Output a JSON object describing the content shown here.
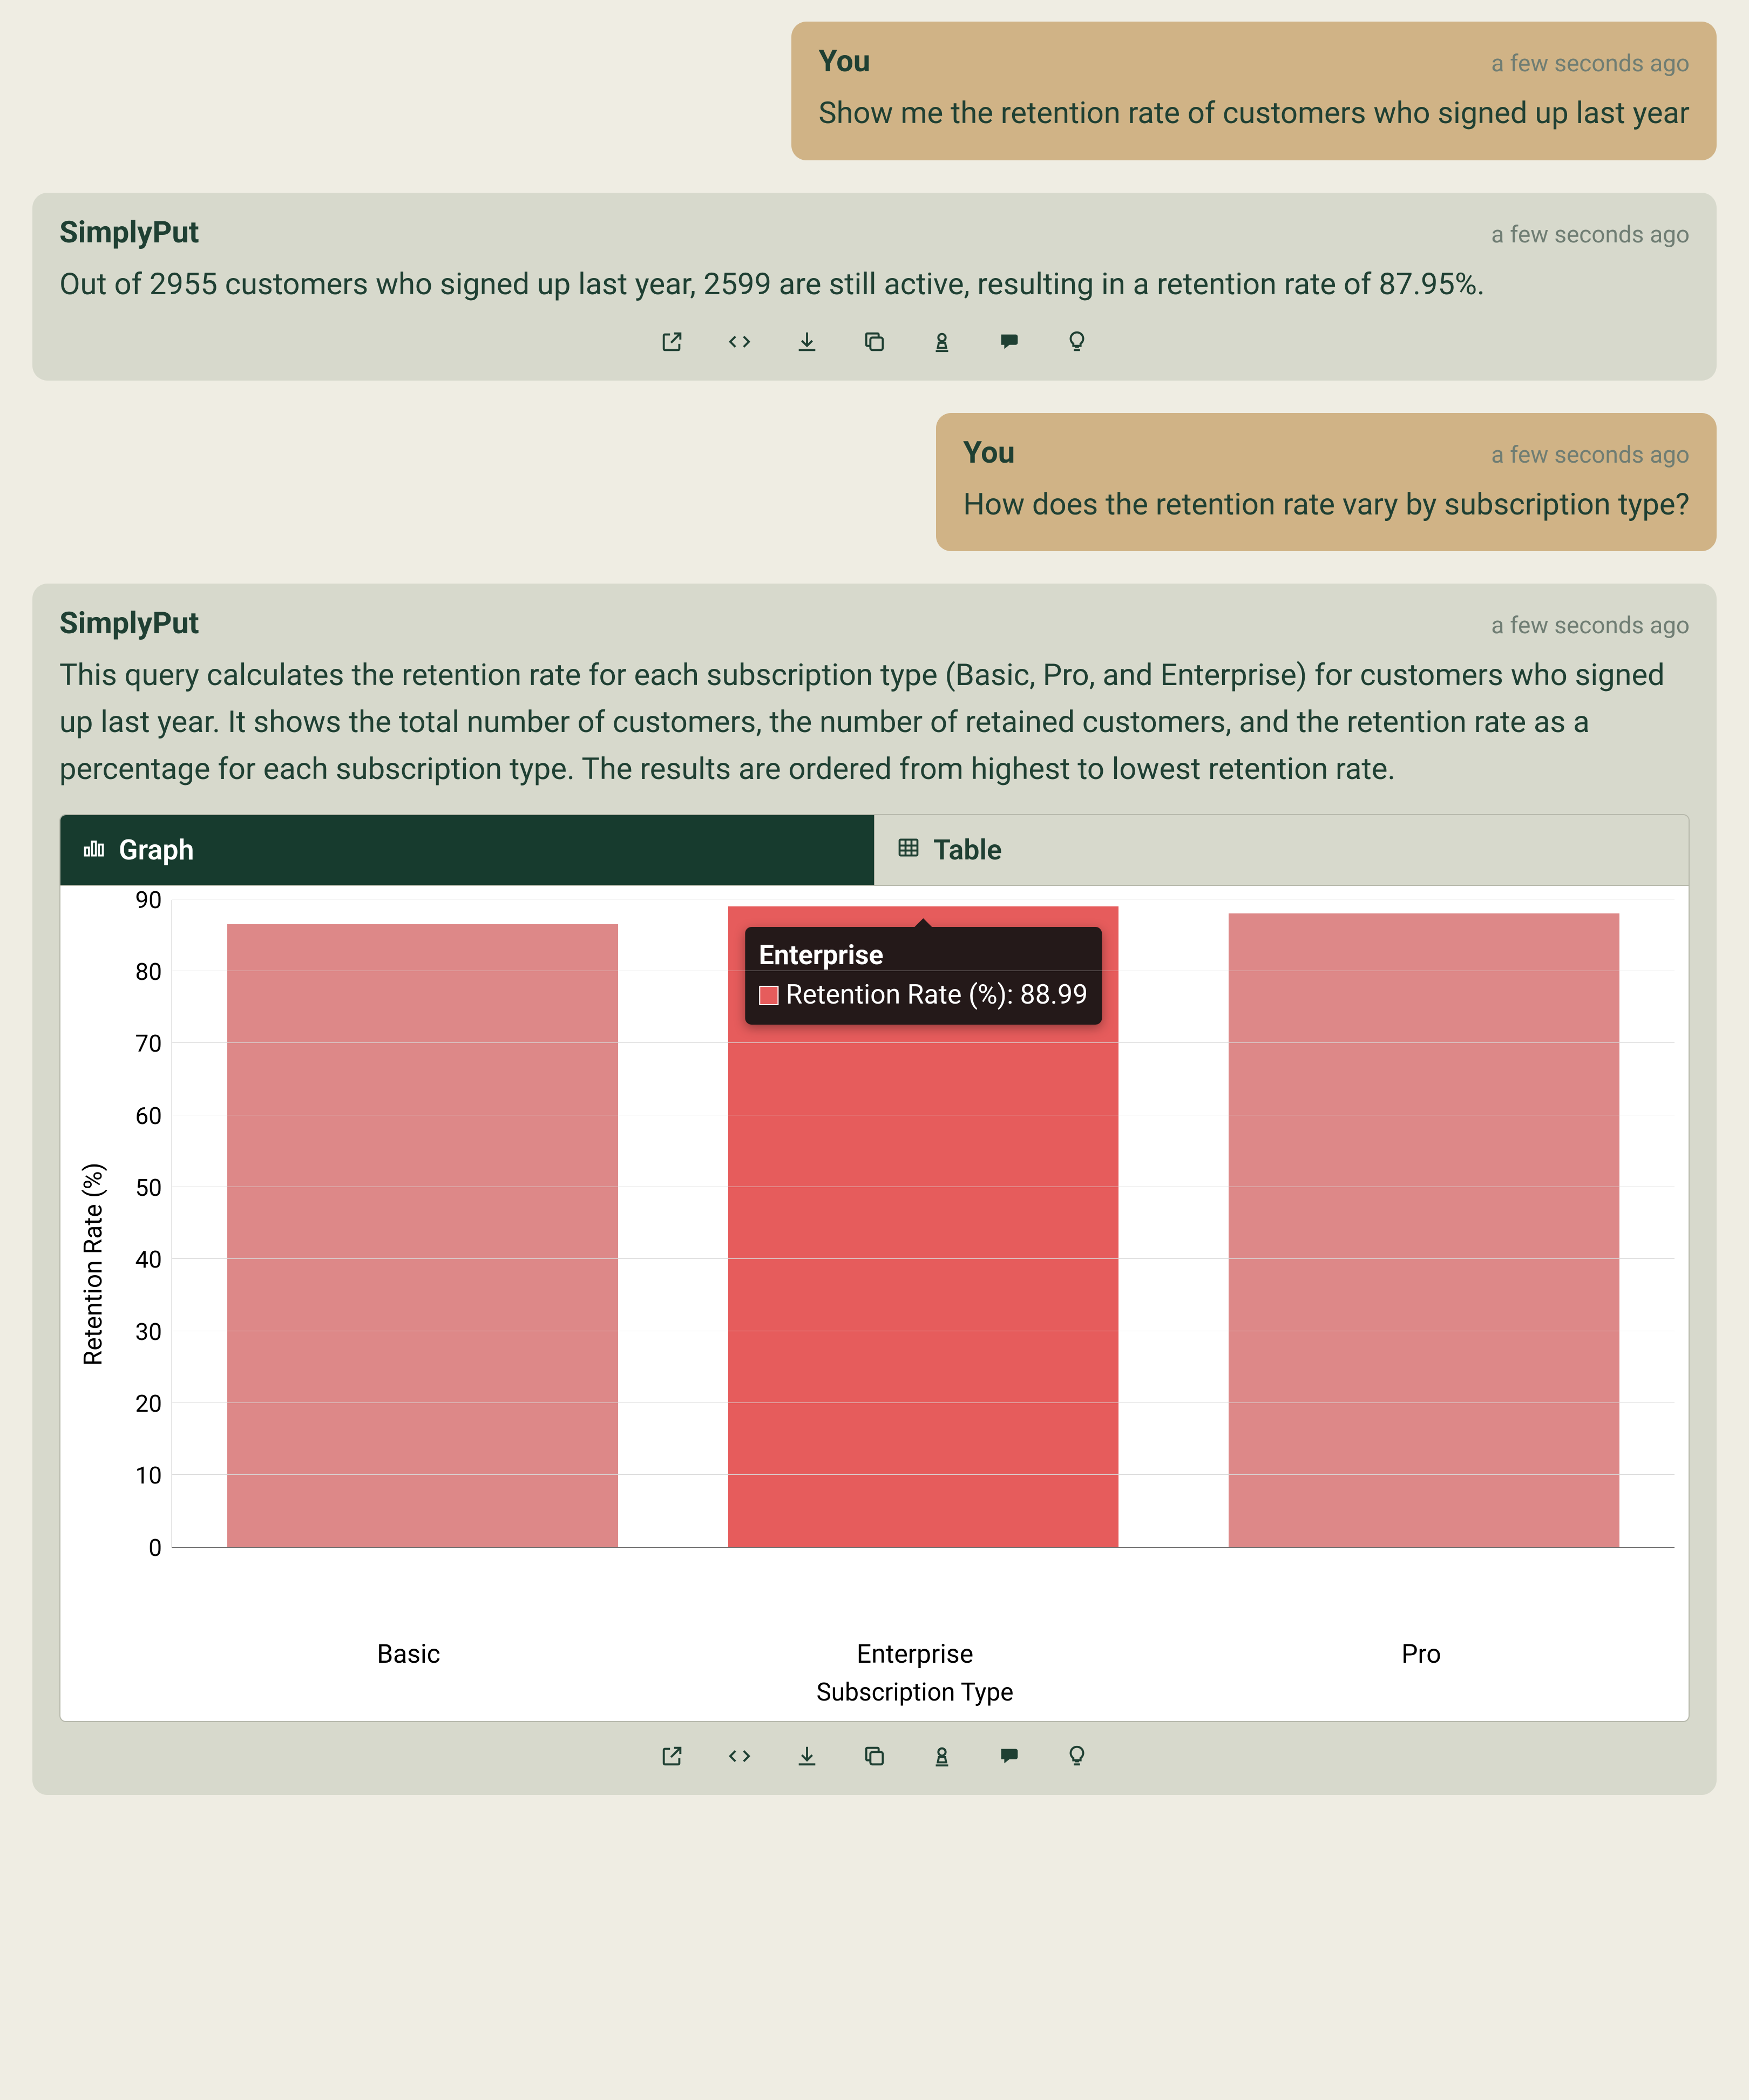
{
  "messages": [
    {
      "role": "user",
      "author": "You",
      "timestamp": "a few seconds ago",
      "text": "Show me the retention rate of customers who signed up last year"
    },
    {
      "role": "assistant",
      "author": "SimplyPut",
      "timestamp": "a few seconds ago",
      "text": "Out of 2955 customers who signed up last year, 2599 are still active, resulting in a retention rate of 87.95%."
    },
    {
      "role": "user",
      "author": "You",
      "timestamp": "a few seconds ago",
      "text": "How does the retention rate vary by subscription type?"
    },
    {
      "role": "assistant",
      "author": "SimplyPut",
      "timestamp": "a few seconds ago",
      "text": "This query calculates the retention rate for each subscription type (Basic, Pro, and Enterprise) for customers who signed up last year. It shows the total number of customers, the number of retained customers, and the retention rate as a percentage for each subscription type. The results are ordered from highest to lowest retention rate."
    }
  ],
  "action_icons": [
    "open-external",
    "code",
    "download",
    "copy",
    "stamp",
    "explain",
    "lightbulb"
  ],
  "tabs": {
    "graph": "Graph",
    "table": "Table",
    "active": "graph"
  },
  "tooltip": {
    "category": "Enterprise",
    "series_label": "Retention Rate (%)",
    "value": "88.99"
  },
  "chart_data": {
    "type": "bar",
    "categories": [
      "Basic",
      "Enterprise",
      "Pro"
    ],
    "values": [
      86.5,
      88.99,
      88.0
    ],
    "highlight_index": 1,
    "title": "",
    "xlabel": "Subscription Type",
    "ylabel": "Retention Rate (%)",
    "ylim": [
      0,
      90
    ],
    "yticks": [
      0,
      10,
      20,
      30,
      40,
      50,
      60,
      70,
      80,
      90
    ],
    "grid": true,
    "colors": {
      "bar": "#DD8888",
      "highlight": "#E65C5C"
    }
  }
}
